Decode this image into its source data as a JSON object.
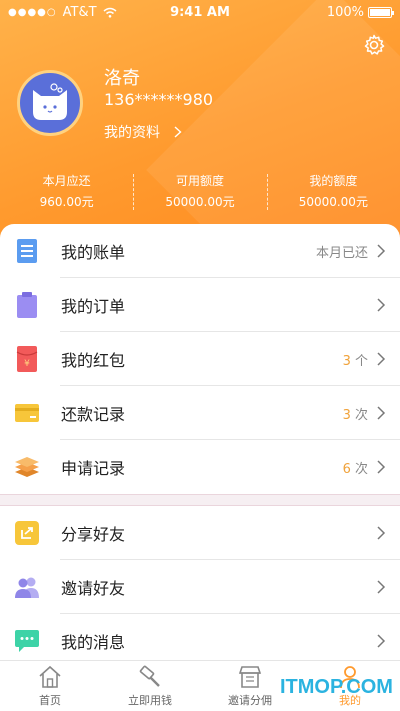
{
  "status_bar": {
    "carrier": "AT&T",
    "time": "9:41 AM",
    "battery": "100%",
    "battery_level": 1.0
  },
  "profile": {
    "name": "洛奇",
    "phone": "136******980",
    "link_label": "我的资料"
  },
  "stats": [
    {
      "label": "本月应还",
      "value": "960.00元"
    },
    {
      "label": "可用额度",
      "value": "50000.00元"
    },
    {
      "label": "我的额度",
      "value": "50000.00元"
    }
  ],
  "menu_group1": [
    {
      "label": "我的账单",
      "right_text": "本月已还",
      "icon": "bill-icon",
      "color": "#5b9cf0"
    },
    {
      "label": "我的订单",
      "icon": "clipboard-icon",
      "color": "#9b8df2"
    },
    {
      "label": "我的红包",
      "count": "3",
      "unit": "个",
      "icon": "red-envelope-icon",
      "color": "#f25a5a"
    },
    {
      "label": "还款记录",
      "count": "3",
      "unit": "次",
      "icon": "card-icon",
      "color": "#f7c63a"
    },
    {
      "label": "申请记录",
      "count": "6",
      "unit": "次",
      "icon": "layers-icon",
      "color": "#f39b3a"
    }
  ],
  "menu_group2": [
    {
      "label": "分享好友",
      "icon": "share-icon",
      "color": "#f7c63a"
    },
    {
      "label": "邀请好友",
      "icon": "users-icon",
      "color": "#8f86e8"
    },
    {
      "label": "我的消息",
      "icon": "message-icon",
      "color": "#3dd3a7"
    }
  ],
  "tabbar": [
    {
      "label": "首页",
      "icon": "home-icon"
    },
    {
      "label": "立即用钱",
      "icon": "hammer-icon"
    },
    {
      "label": "邀请分佣",
      "icon": "store-icon"
    },
    {
      "label": "我的",
      "icon": "person-icon",
      "active": true
    }
  ],
  "watermark": "ITMOP.COM",
  "colors": {
    "accent": "#ff9a2e",
    "count": "#f0a23a"
  }
}
